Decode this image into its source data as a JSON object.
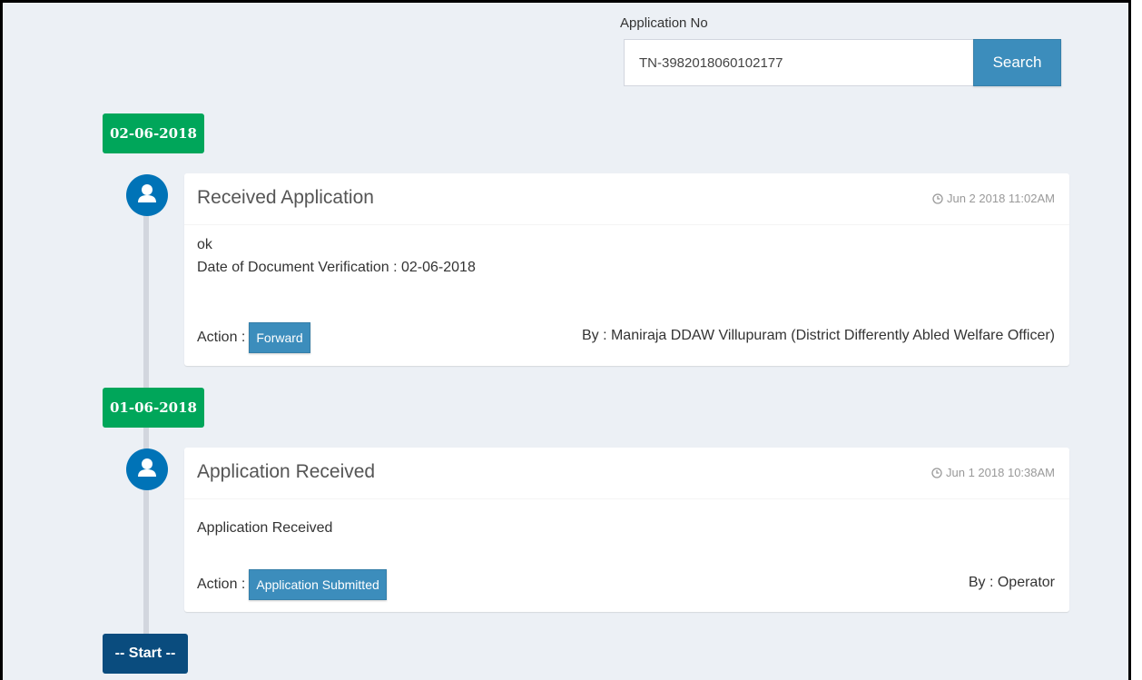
{
  "search": {
    "label": "Application No",
    "value": "TN-3982018060102177",
    "button_label": "Search"
  },
  "timeline": {
    "entries": [
      {
        "date": "02-06-2018",
        "title": "Received Application",
        "time": "Jun 2 2018 11:02AM",
        "lines": [
          "ok",
          "Date of Document Verification : 02-06-2018"
        ],
        "action_label": "Action :",
        "action": "Forward",
        "by": "By : Maniraja DDAW Villupuram (District Differently Abled Welfare Officer)"
      },
      {
        "date": "01-06-2018",
        "title": "Application Received",
        "time": "Jun 1 2018 10:38AM",
        "lines": [
          "Application Received"
        ],
        "action_label": "Action :",
        "action": "Application Submitted",
        "by": "By : Operator"
      }
    ],
    "start_label": "-- Start --"
  },
  "colors": {
    "date_badge": "#00a65a",
    "icon_circle": "#0073b7",
    "action_badge": "#3c8dbc",
    "start_badge": "#0a4c7e"
  }
}
